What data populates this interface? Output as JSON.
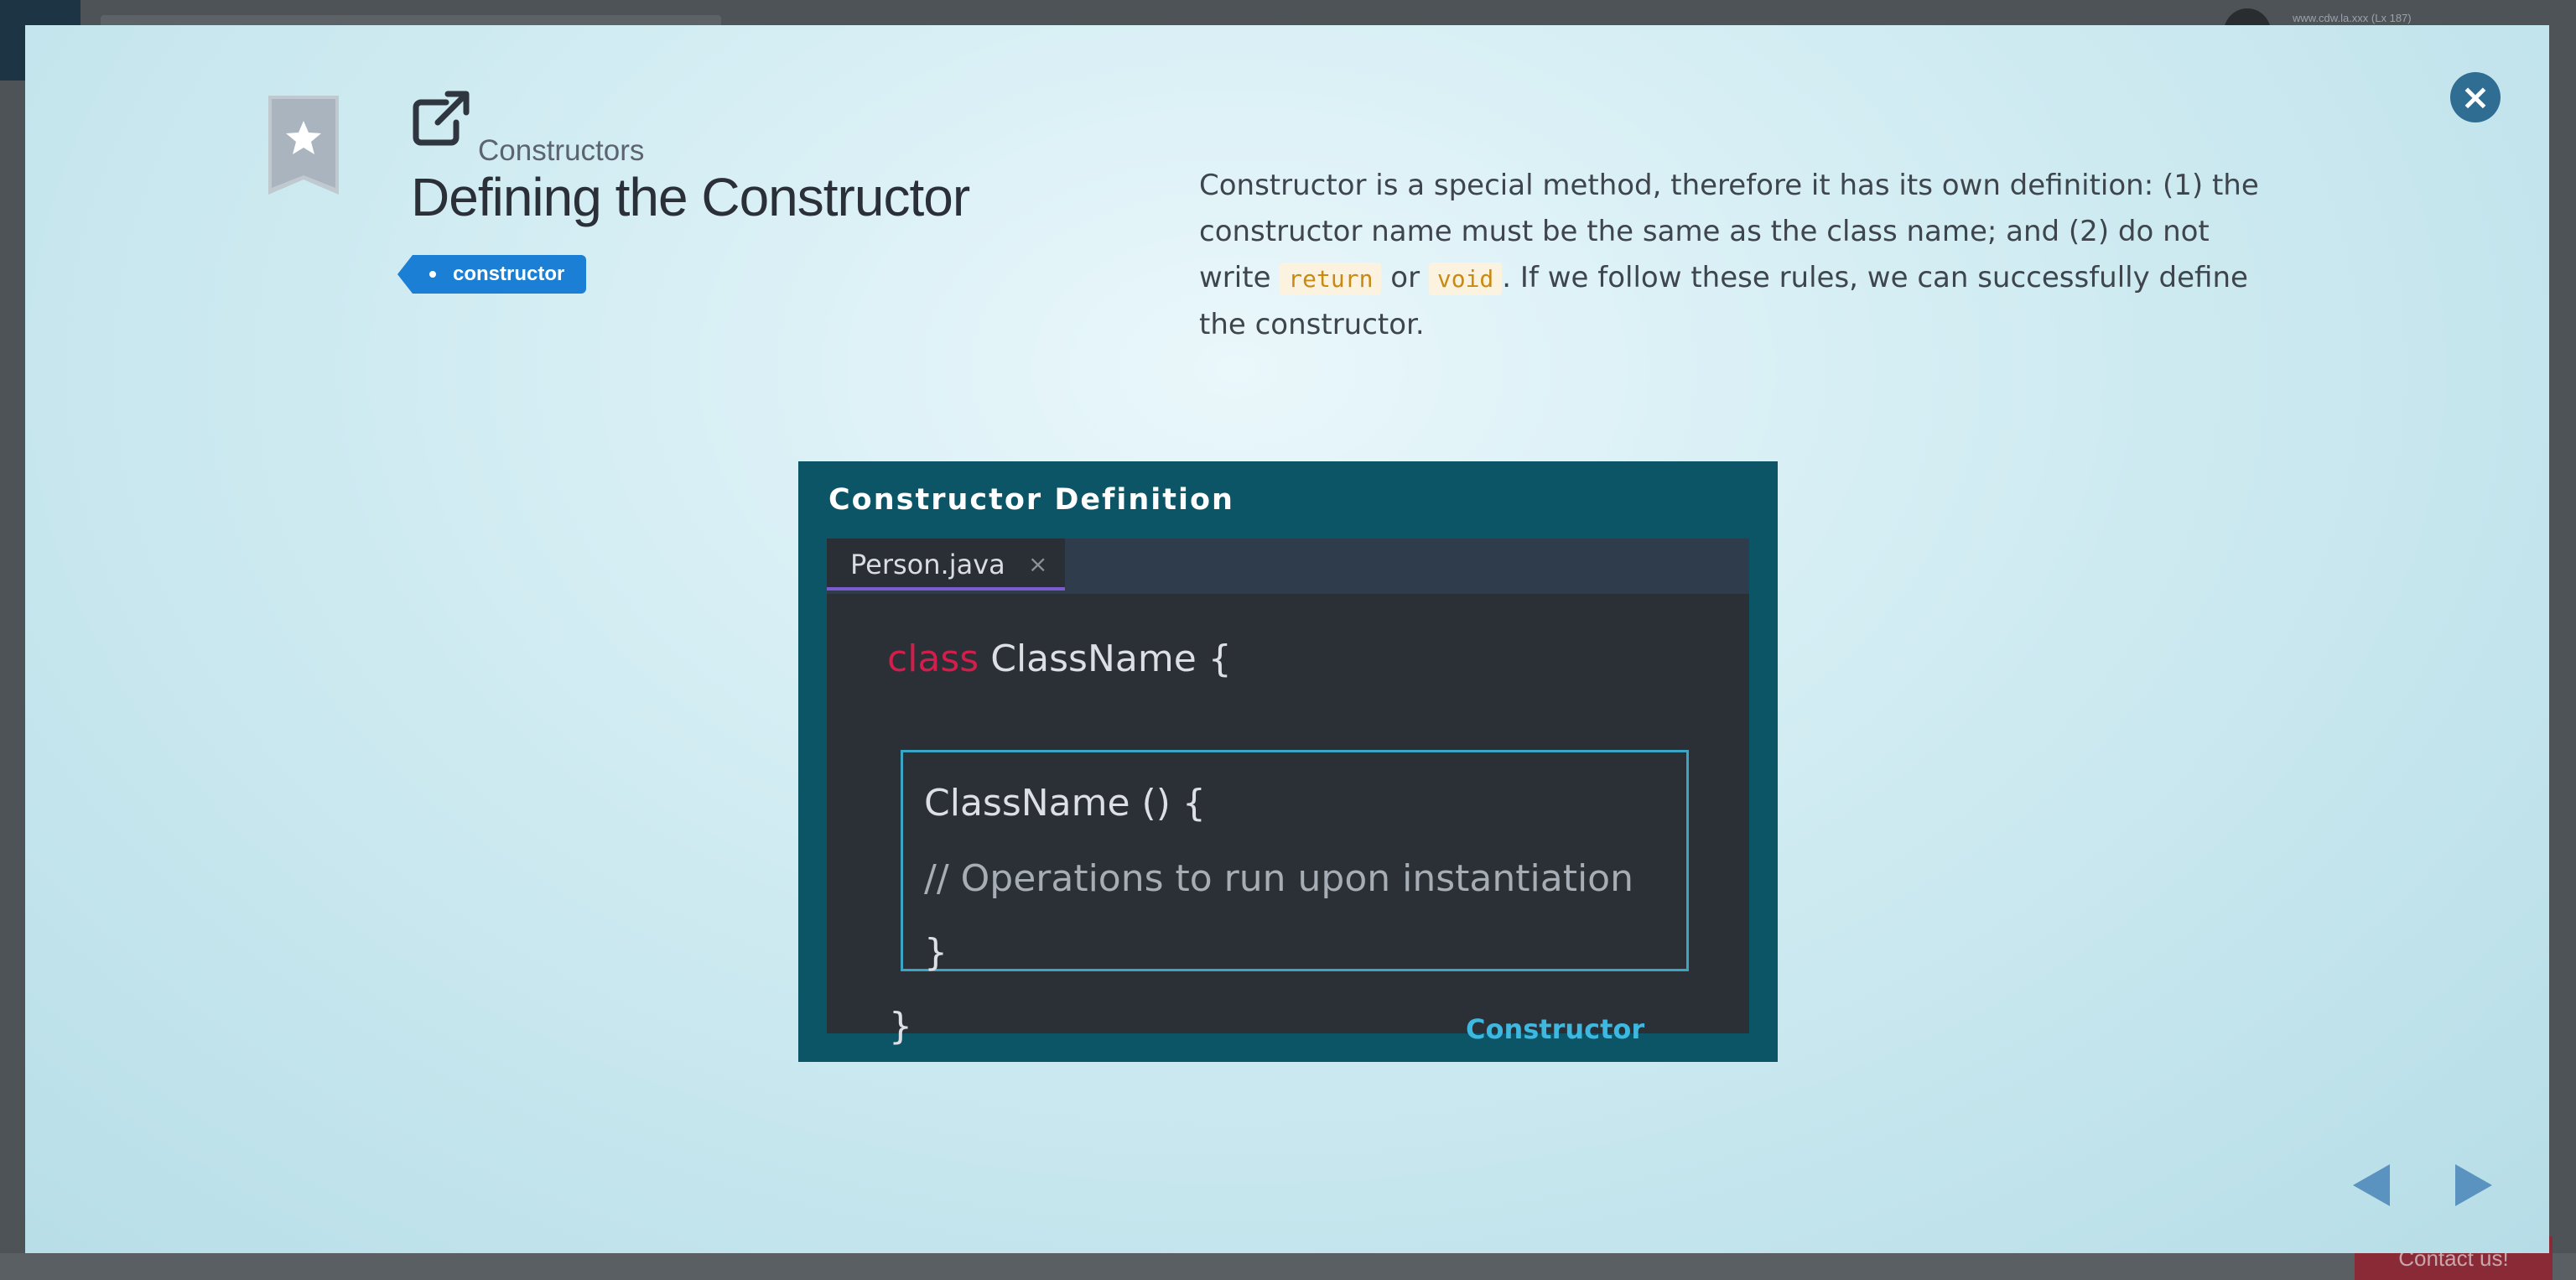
{
  "background": {
    "url_text": "www.cdw.la.xxx (Lx 187)",
    "contact_label": "Contact us!"
  },
  "modal": {
    "breadcrumb": "Constructors",
    "title": "Defining the Constructor",
    "tag": "constructor",
    "description": {
      "part1": "Constructor is a special method, therefore it has its own definition: (1) the constructor name must be the same as the class name; and (2) do not write ",
      "code1": "return",
      "part2": " or ",
      "code2": "void",
      "part3": ". If we follow these rules, we can successfully define the constructor."
    },
    "icons": {
      "bookmark": "bookmark-star-icon",
      "external": "external-link-icon",
      "close": "close-icon",
      "prev": "arrow-left-icon",
      "next": "arrow-right-icon"
    },
    "colors": {
      "accent": "#1b7fd6",
      "close": "#2f6d93",
      "diagram_bg": "#0b5566",
      "keyword": "#d31e4c",
      "highlight": "#3ba5c6"
    }
  },
  "diagram": {
    "title": "Constructor Definition",
    "file_tab": "Person.java",
    "tab_close": "×",
    "keyword": "class",
    "line1_rest": " ClassName {",
    "line2": "ClassName () {",
    "line3": "// Operations to run upon instantiation",
    "line4": "}",
    "line5": "}",
    "label": "Constructor"
  }
}
